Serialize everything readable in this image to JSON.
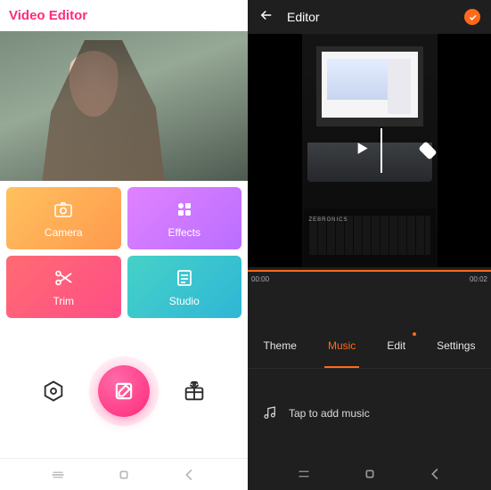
{
  "left": {
    "app_title": "Video Editor",
    "tiles": {
      "camera": {
        "label": "Camera"
      },
      "effects": {
        "label": "Effects"
      },
      "trim": {
        "label": "Trim"
      },
      "studio": {
        "label": "Studio"
      }
    }
  },
  "right": {
    "header_title": "Editor",
    "timeline": {
      "start": "00:00",
      "end": "00:02"
    },
    "tabs": {
      "theme": {
        "label": "Theme"
      },
      "music": {
        "label": "Music"
      },
      "edit": {
        "label": "Edit"
      },
      "settings": {
        "label": "Settings"
      },
      "active": "music",
      "badge_on": "edit"
    },
    "music_prompt": "Tap to add music",
    "preview_brand": "ZEBRONICS"
  }
}
